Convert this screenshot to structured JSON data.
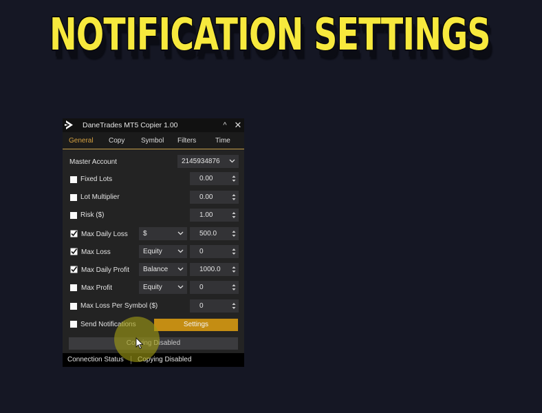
{
  "headline": "NOTIFICATION SETTINGS",
  "colors": {
    "background": "#151724",
    "headline": "#f7e93d",
    "accent_tab": "#d6a241",
    "settings_button": "#c48d13",
    "window_bg": "#232323"
  },
  "window": {
    "title": "DaneTrades MT5 Copier 1.00",
    "logo_icon": "play-arrow-logo",
    "controls": {
      "collapse_icon": "^",
      "close_icon": "✕"
    }
  },
  "tabs": [
    {
      "label": "General",
      "active": true
    },
    {
      "label": "Copy",
      "active": false
    },
    {
      "label": "Symbol",
      "active": false
    },
    {
      "label": "Filters",
      "active": false
    },
    {
      "label": "Time",
      "active": false
    }
  ],
  "general": {
    "master_account": {
      "label": "Master Account",
      "value": "2145934876"
    },
    "rows": [
      {
        "label": "Fixed Lots",
        "checked": false,
        "value": "0.00"
      },
      {
        "label": "Lot Multiplier",
        "checked": false,
        "value": "0.00"
      },
      {
        "label": "Risk ($)",
        "checked": false,
        "value": "1.00"
      },
      {
        "label": "Max Daily Loss",
        "checked": true,
        "mode": "$",
        "value": "500.0"
      },
      {
        "label": "Max Loss",
        "checked": true,
        "mode": "Equity",
        "value": "0"
      },
      {
        "label": "Max Daily Profit",
        "checked": true,
        "mode": "Balance",
        "value": "1000.0"
      },
      {
        "label": "Max Profit",
        "checked": false,
        "mode": "Equity",
        "value": "0"
      },
      {
        "label": "Max Loss Per Symbol ($)",
        "checked": false,
        "value": "0"
      }
    ],
    "send_notifications": {
      "label": "Send Notifications",
      "checked": false
    },
    "settings_button": "Settings",
    "copying_button": "Copying Disabled"
  },
  "status_bar": {
    "left": "Connection Status",
    "right": "Copying Disabled"
  }
}
